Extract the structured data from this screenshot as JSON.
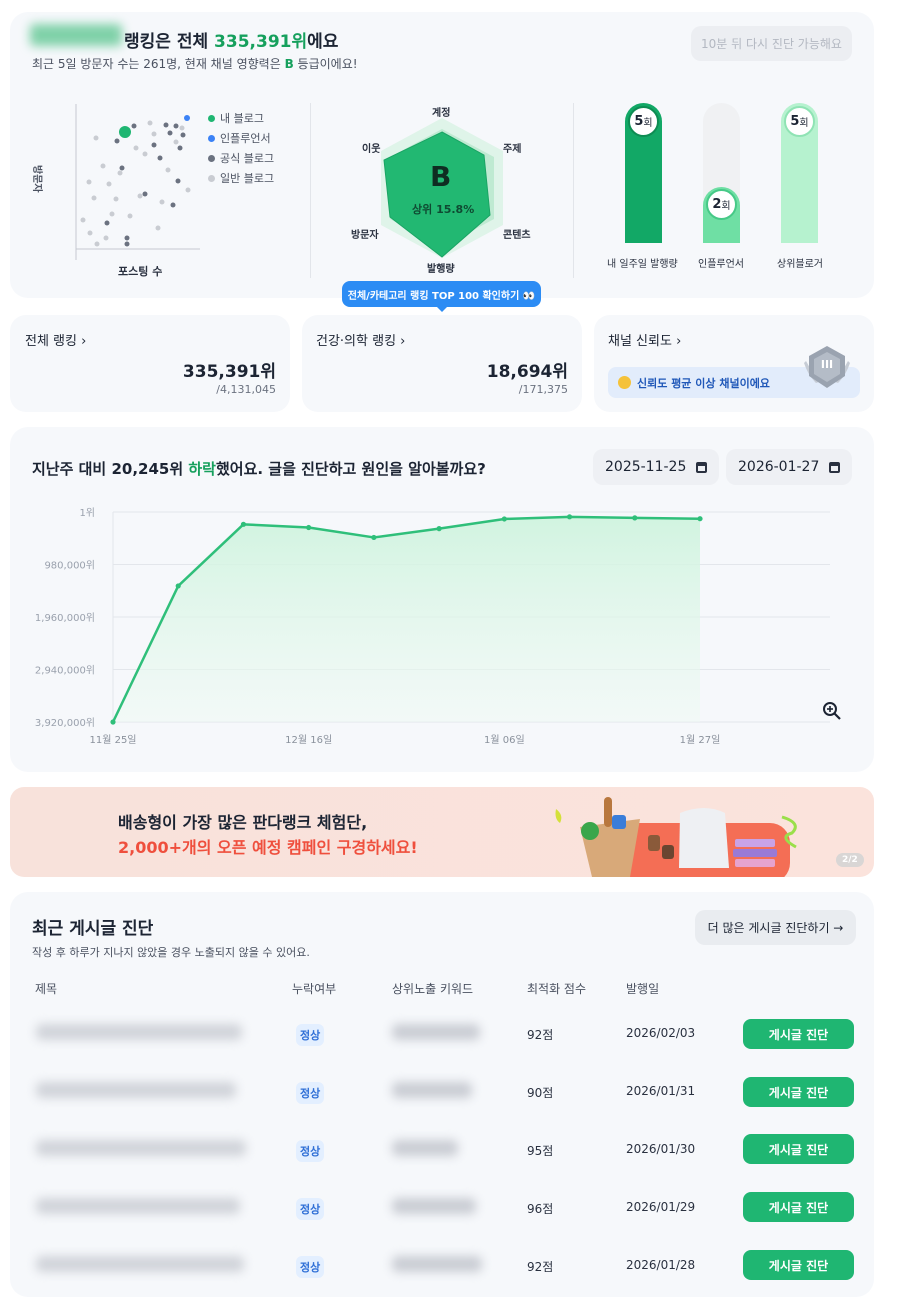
{
  "header": {
    "title_prefix": "랭킹은 전체 ",
    "rank": "335,391위",
    "title_suffix": "에요",
    "subtitle_a": "최근 5일 방문자 수는 261명, 현재 채널 영향력은 ",
    "grade": "B",
    "subtitle_b": " 등급이에요!",
    "retry_label": "10분 뒤 다시 진단 가능해요"
  },
  "scatter": {
    "legend": [
      "내 블로그",
      "인플루언서",
      "공식 블로그",
      "일반 블로그"
    ],
    "y_label": "방문자",
    "x_label": "포스팅 수",
    "colors": {
      "mine": "#1fb672",
      "influencer": "#3b82f6",
      "official": "#6b7280",
      "general": "#c9ccd2"
    }
  },
  "radar": {
    "axes": [
      "계정",
      "주제",
      "콘텐츠",
      "발행량",
      "방문자",
      "이웃"
    ],
    "grade": "B",
    "percentile": "상위 15.8%"
  },
  "frequency": {
    "bars": [
      {
        "label": "내 일주일 발행량",
        "value": "5",
        "unit": "회",
        "color": "#12a866"
      },
      {
        "label": "인플루언서",
        "value": "2",
        "unit": "회",
        "color": "#6fdfa4"
      },
      {
        "label": "상위블로거",
        "value": "5",
        "unit": "회",
        "color": "#b6f2cf"
      }
    ]
  },
  "tooltip": {
    "label": "전체/카테고리 랭킹 TOP 100 확인하기 👀"
  },
  "rank_cards": [
    {
      "title": "전체 랭킹",
      "value": "335,391위",
      "total": "/4,131,045"
    },
    {
      "title": "건강·의학 랭킹",
      "value": "18,694위",
      "total": "/171,375"
    }
  ],
  "trust": {
    "title": "채널 신뢰도",
    "badge": "신뢰도 평균 이상 채널이에요",
    "emblem": "III"
  },
  "trend": {
    "title_a": "지난주 대비 20,245위 ",
    "title_drop": "하락",
    "title_b": "했어요. 글을 진단하고 원인을 알아볼까요?",
    "date_start": "2025-11-25",
    "date_end": "2026-01-27",
    "zoom_icon": "zoom-in-icon"
  },
  "chart_data": {
    "type": "area",
    "title": "",
    "y_axis_inverted": true,
    "ylim": [
      3920000,
      1
    ],
    "y_ticks": [
      "1위",
      "980,000위",
      "1,960,000위",
      "2,940,000위",
      "3,920,000위"
    ],
    "y_tick_values": [
      1,
      980000,
      1960000,
      2940000,
      3920000
    ],
    "x_ticks": [
      "11월 25일",
      "12월 16일",
      "1월 06일",
      "1월 27일"
    ],
    "x": [
      "2025-11-25",
      "2025-12-02",
      "2025-12-09",
      "2025-12-16",
      "2025-12-23",
      "2025-12-30",
      "2026-01-06",
      "2026-01-13",
      "2026-01-20",
      "2026-01-27"
    ],
    "series": [
      {
        "values": [
          3920000,
          1380000,
          230000,
          290000,
          475000,
          310000,
          130000,
          90000,
          110000,
          125000
        ],
        "color": "#2fbf7a"
      }
    ],
    "grid": true
  },
  "banner": {
    "line1": "배송형이 가장 많은 판다랭크 체험단,",
    "line2": "2,000+개의 오픈 예정 캠페인 구경하세요!",
    "page": "2/2"
  },
  "posts": {
    "title": "최근 게시글 진단",
    "subtitle": "작성 후 하루가 지나지 않았을 경우 노출되지 않을 수 있어요.",
    "more_label": "더 많은 게시글 진단하기 →",
    "columns": [
      "제목",
      "누락여부",
      "상위노출 키워드",
      "최적화 점수",
      "발행일"
    ],
    "rows": [
      {
        "status": "정상",
        "score": "92점",
        "date": "2026/02/03",
        "action": "게시글 진단"
      },
      {
        "status": "정상",
        "score": "90점",
        "date": "2026/01/31",
        "action": "게시글 진단"
      },
      {
        "status": "정상",
        "score": "95점",
        "date": "2026/01/30",
        "action": "게시글 진단"
      },
      {
        "status": "정상",
        "score": "96점",
        "date": "2026/01/29",
        "action": "게시글 진단"
      },
      {
        "status": "정상",
        "score": "92점",
        "date": "2026/01/28",
        "action": "게시글 진단"
      }
    ]
  }
}
